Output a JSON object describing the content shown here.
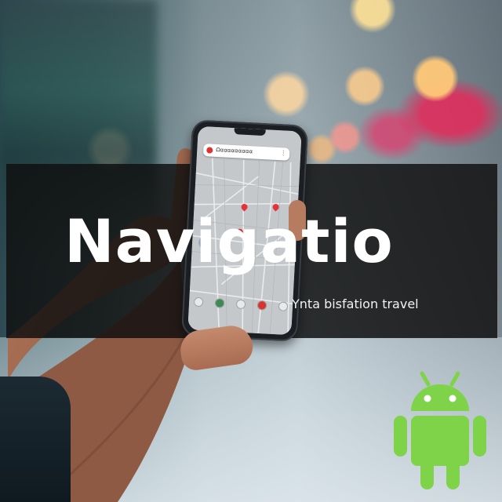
{
  "overlay": {
    "title": "Navigatio",
    "subtitle": "Ynta bisfation travel"
  },
  "phone": {
    "search_text": "Ωααααααααα",
    "more_glyph": "⋮"
  },
  "icons": {
    "android": "android-robot-icon",
    "map_pin": "map-pin-icon",
    "location": "location-dot-icon"
  },
  "colors": {
    "android_green": "#7ed348",
    "banner_bg": "#0f0f0f",
    "title_text": "#ffffff"
  }
}
